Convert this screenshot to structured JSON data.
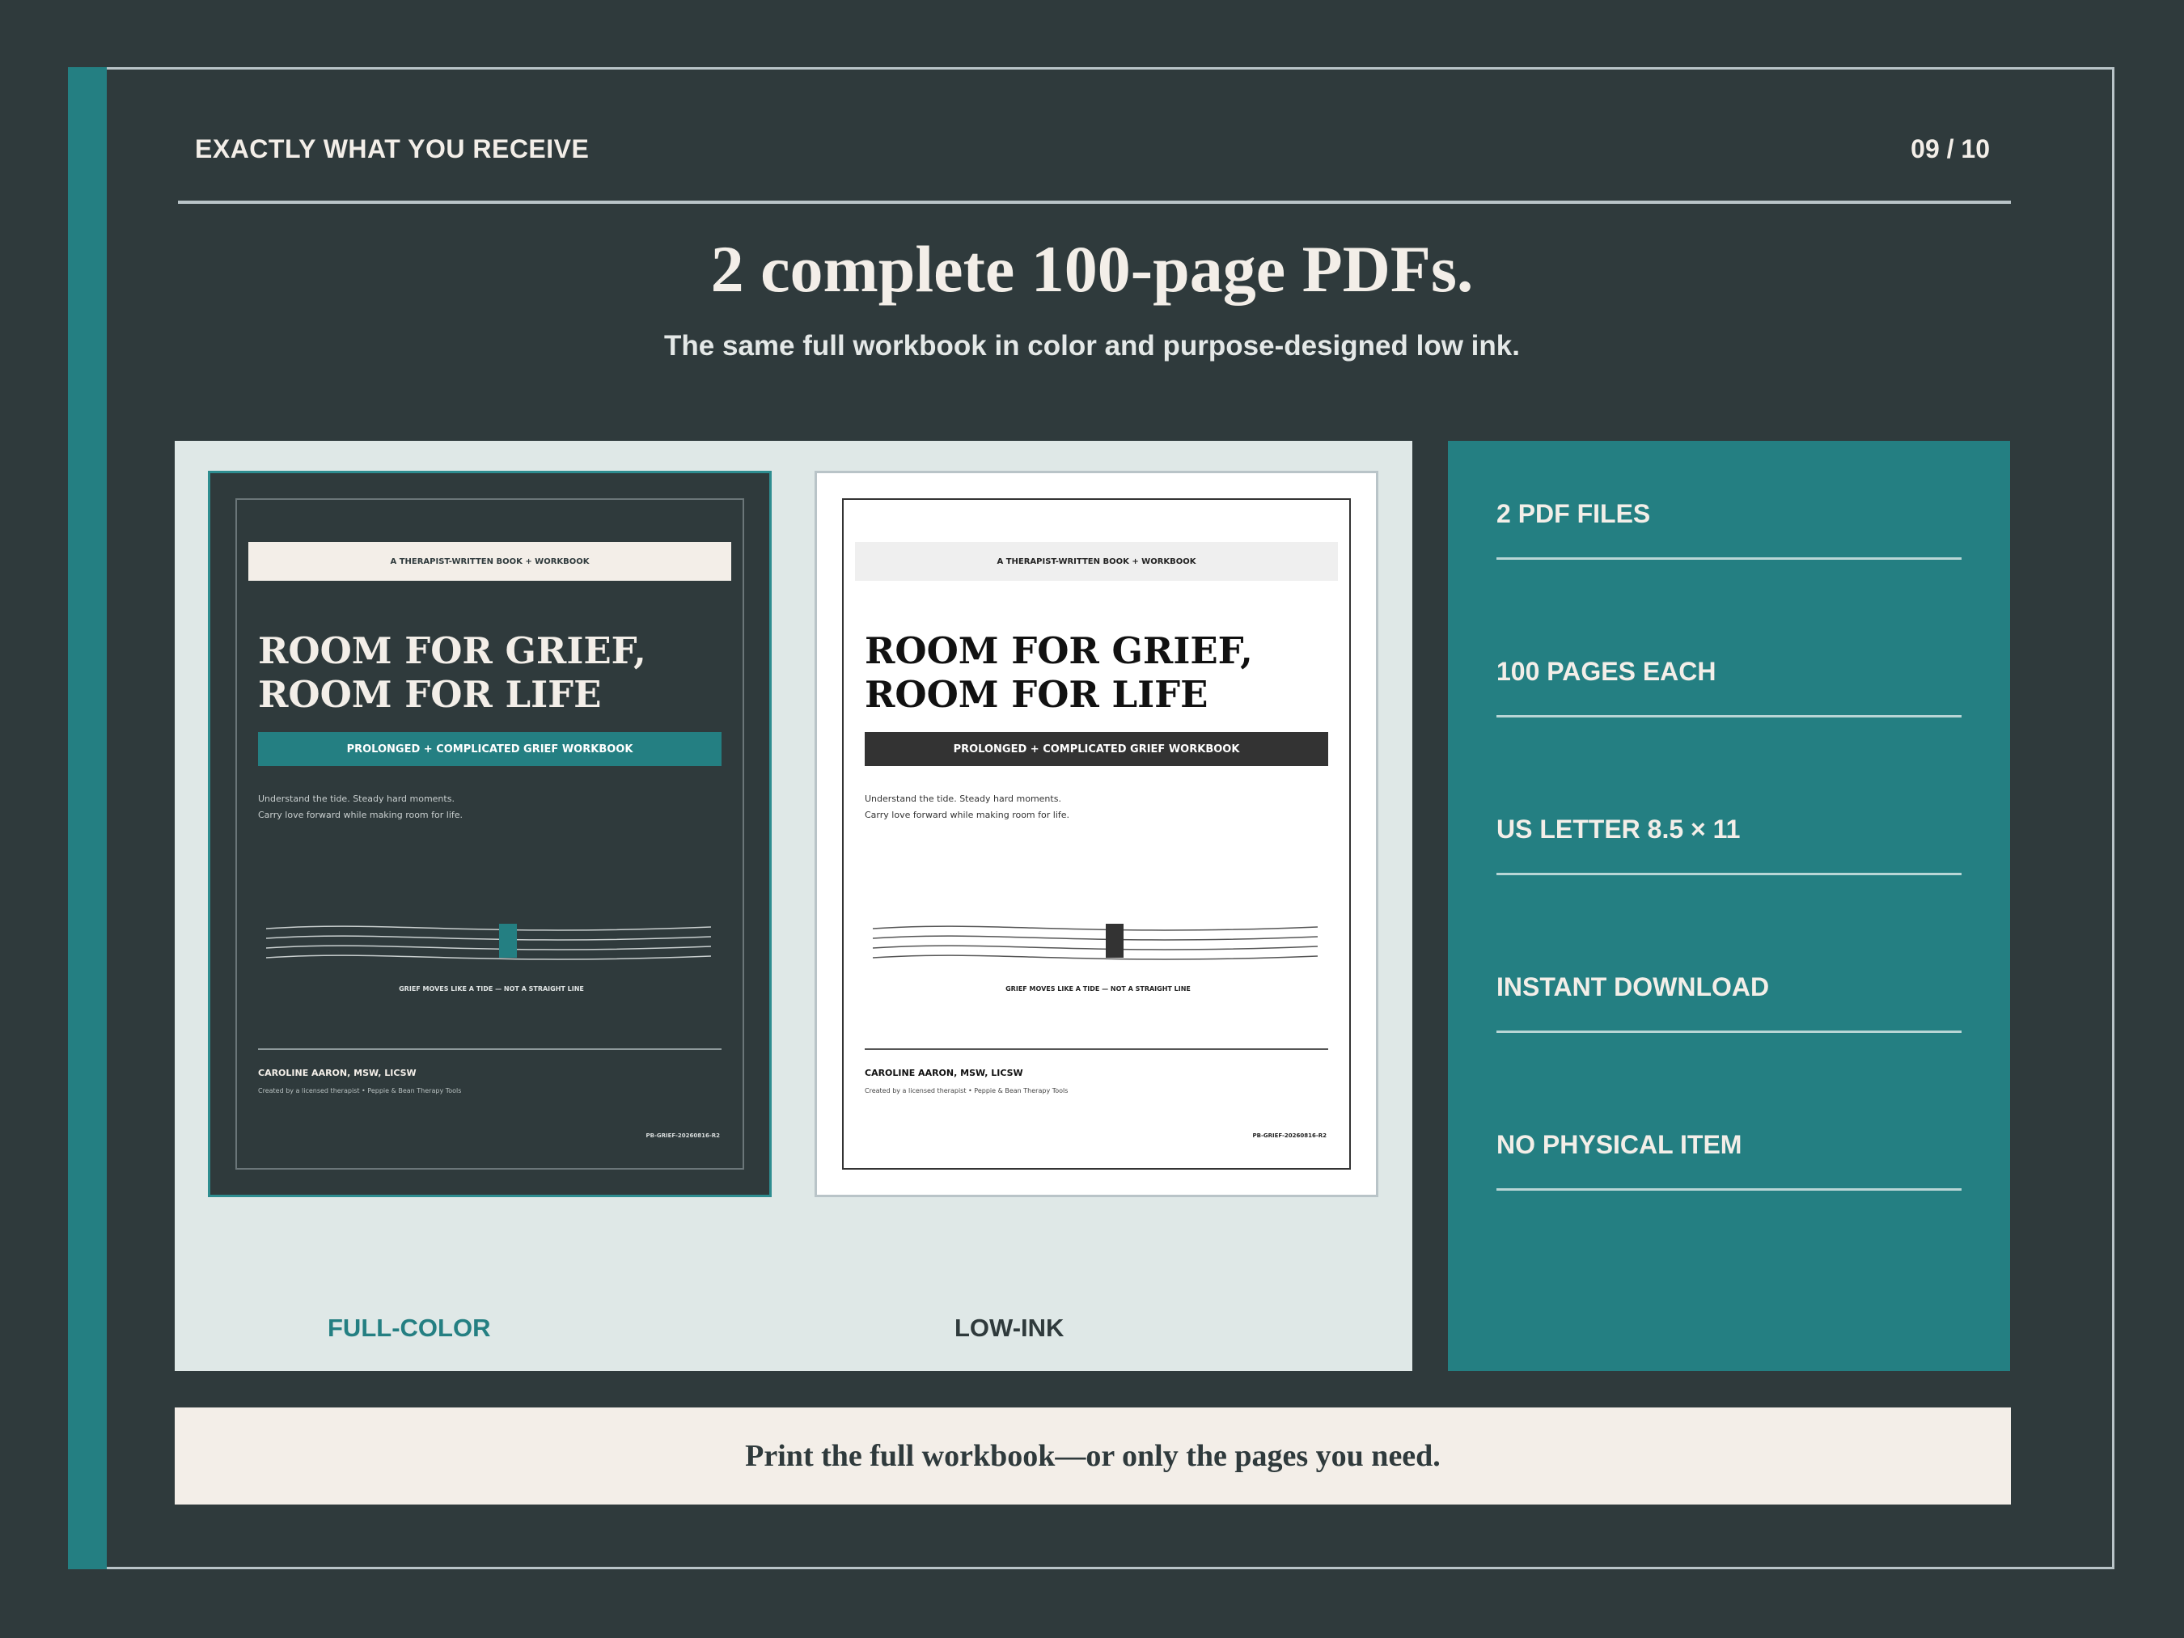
{
  "header": {
    "eyebrow": "EXACTLY WHAT YOU RECEIVE",
    "pager": "09 / 10"
  },
  "headline": "2 complete 100-page PDFs.",
  "subheadline": "The same full workbook in color and purpose-designed low ink.",
  "covers": {
    "full_color": {
      "kicker": "A THERAPIST-WRITTEN BOOK + WORKBOOK",
      "title_line1": "ROOM FOR GRIEF,",
      "title_line2": "ROOM FOR LIFE",
      "subtitle": "PROLONGED + COMPLICATED GRIEF WORKBOOK",
      "blurb_line1": "Understand the tide. Steady hard moments.",
      "blurb_line2": "Carry love forward while making room for life.",
      "tide_caption": "GRIEF MOVES LIKE A TIDE — NOT A STRAIGHT LINE",
      "author": "CAROLINE AARON, MSW, LICSW",
      "credit": "Created by a licensed therapist • Peppie & Bean Therapy Tools",
      "code": "PB-GRIEF-20260816-R2",
      "label": "FULL-COLOR"
    },
    "low_ink": {
      "kicker": "A THERAPIST-WRITTEN BOOK + WORKBOOK",
      "title_line1": "ROOM FOR GRIEF,",
      "title_line2": "ROOM FOR LIFE",
      "subtitle": "PROLONGED + COMPLICATED GRIEF WORKBOOK",
      "blurb_line1": "Understand the tide. Steady hard moments.",
      "blurb_line2": "Carry love forward while making room for life.",
      "tide_caption": "GRIEF MOVES LIKE A TIDE — NOT A STRAIGHT LINE",
      "author": "CAROLINE AARON, MSW, LICSW",
      "credit": "Created by a licensed therapist • Peppie & Bean Therapy Tools",
      "code": "PB-GRIEF-20260816-R2",
      "label": "LOW-INK"
    }
  },
  "specs": [
    "2 PDF FILES",
    "100 PAGES EACH",
    "US LETTER 8.5 × 11",
    "INSTANT DOWNLOAD",
    "NO PHYSICAL ITEM"
  ],
  "footer": "Print the full workbook—or only the pages you need.",
  "colors": {
    "background": "#2f3a3c",
    "accent": "#247f82",
    "cream": "#f3eee8",
    "panel": "#dfe8e7"
  }
}
